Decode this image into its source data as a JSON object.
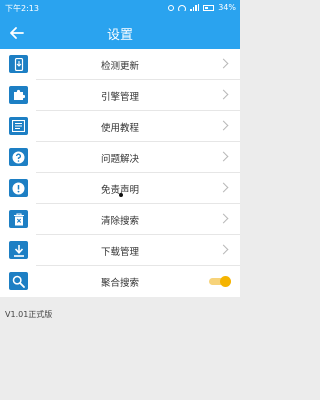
{
  "status_bar": {
    "time": "下午2:13",
    "battery": "34%"
  },
  "app_bar": {
    "title": "设置"
  },
  "menu": [
    {
      "label": "检测更新",
      "icon": "update-icon"
    },
    {
      "label": "引擎管理",
      "icon": "puzzle-icon"
    },
    {
      "label": "使用教程",
      "icon": "document-icon"
    },
    {
      "label": "问题解决",
      "icon": "help-icon"
    },
    {
      "label": "免责声明",
      "icon": "alert-icon"
    },
    {
      "label": "清除搜索",
      "icon": "trash-icon"
    },
    {
      "label": "下载管理",
      "icon": "download-icon"
    },
    {
      "label": "聚合搜索",
      "icon": "search-icon",
      "toggle_on": true
    }
  ],
  "version": "V1.01正式版",
  "colors": {
    "primary": "#2aa3ef",
    "icon_bg": "#1d7fc4",
    "toggle": "#f5b400"
  }
}
